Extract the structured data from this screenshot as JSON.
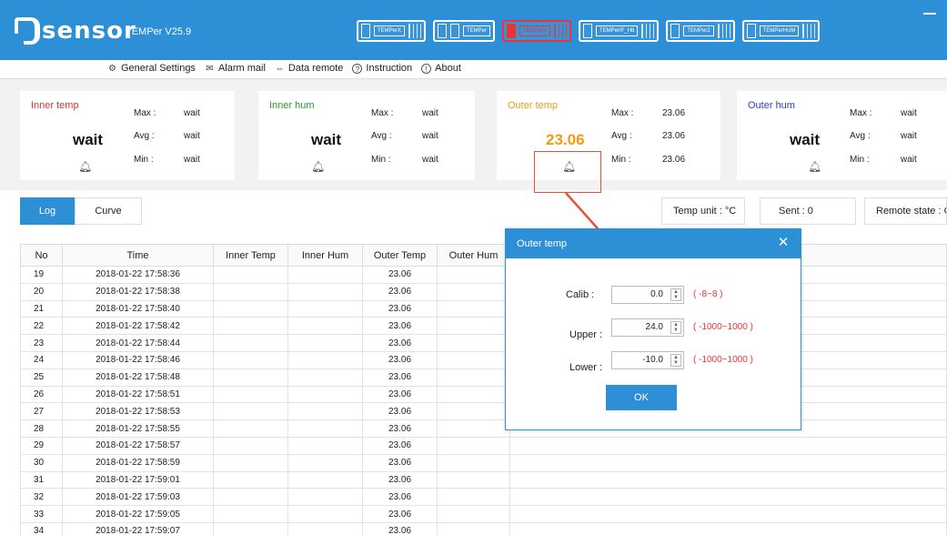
{
  "app": {
    "logo_text": "sensor",
    "version": "TEMPer V25.9"
  },
  "devices": [
    {
      "label": "TEMPerX",
      "active": false
    },
    {
      "label": "TEMPer",
      "active": false
    },
    {
      "label": "TEMPerX",
      "active": true
    },
    {
      "label": "TEMPerIF_H8",
      "active": false
    },
    {
      "label": "TEMPer2",
      "active": false
    },
    {
      "label": "TEMPerHUM",
      "active": false
    }
  ],
  "menu": {
    "general_settings": "General Settings",
    "alarm_mail": "Alarm mail",
    "data_remote": "Data remote",
    "instruction": "Instruction",
    "about": "About"
  },
  "panels": {
    "inner_temp": {
      "title": "Inner temp",
      "value": "wait",
      "max_label": "Max :",
      "max": "wait",
      "avg_label": "Avg :",
      "avg": "wait",
      "min_label": "Min :",
      "min": "wait",
      "color": "#e33030"
    },
    "inner_hum": {
      "title": "Inner hum",
      "value": "wait",
      "max_label": "Max :",
      "max": "wait",
      "avg_label": "Avg :",
      "avg": "wait",
      "min_label": "Min :",
      "min": "wait",
      "color": "#2a9a2a"
    },
    "outer_temp": {
      "title": "Outer temp",
      "value": "23.06",
      "max_label": "Max :",
      "max": "23.06",
      "avg_label": "Avg :",
      "avg": "23.06",
      "min_label": "Min :",
      "min": "23.06",
      "color": "#f59a12"
    },
    "outer_hum": {
      "title": "Outer hum",
      "value": "wait",
      "max_label": "Max :",
      "max": "wait",
      "avg_label": "Avg :",
      "avg": "wait",
      "min_label": "Min :",
      "min": "wait",
      "color": "#2a3fc2"
    }
  },
  "tabs": {
    "log": "Log",
    "curve": "Curve"
  },
  "status": {
    "temp_unit": "Temp unit : °C",
    "sent": "Sent :   0",
    "remote_state": "Remote state : OFF"
  },
  "table": {
    "headers": [
      "No",
      "Time",
      "Inner Temp",
      "Inner Hum",
      "Outer Temp",
      "Outer Hum"
    ],
    "rows": [
      [
        "19",
        "2018-01-22 17:58:36",
        "",
        "",
        "23.06",
        ""
      ],
      [
        "20",
        "2018-01-22 17:58:38",
        "",
        "",
        "23.06",
        ""
      ],
      [
        "21",
        "2018-01-22 17:58:40",
        "",
        "",
        "23.06",
        ""
      ],
      [
        "22",
        "2018-01-22 17:58:42",
        "",
        "",
        "23.06",
        ""
      ],
      [
        "23",
        "2018-01-22 17:58:44",
        "",
        "",
        "23.06",
        ""
      ],
      [
        "24",
        "2018-01-22 17:58:46",
        "",
        "",
        "23.06",
        ""
      ],
      [
        "25",
        "2018-01-22 17:58:48",
        "",
        "",
        "23.06",
        ""
      ],
      [
        "26",
        "2018-01-22 17:58:51",
        "",
        "",
        "23.06",
        ""
      ],
      [
        "27",
        "2018-01-22 17:58:53",
        "",
        "",
        "23.06",
        ""
      ],
      [
        "28",
        "2018-01-22 17:58:55",
        "",
        "",
        "23.06",
        ""
      ],
      [
        "29",
        "2018-01-22 17:58:57",
        "",
        "",
        "23.06",
        ""
      ],
      [
        "30",
        "2018-01-22 17:58:59",
        "",
        "",
        "23.06",
        ""
      ],
      [
        "31",
        "2018-01-22 17:59:01",
        "",
        "",
        "23.06",
        ""
      ],
      [
        "32",
        "2018-01-22 17:59:03",
        "",
        "",
        "23.06",
        ""
      ],
      [
        "33",
        "2018-01-22 17:59:05",
        "",
        "",
        "23.06",
        ""
      ],
      [
        "34",
        "2018-01-22 17:59:07",
        "",
        "",
        "23.06",
        ""
      ]
    ]
  },
  "dialog": {
    "title": "Outer temp",
    "calib_label": "Calib :",
    "calib_value": "0.0",
    "calib_range": "( -8~8 )",
    "upper_label": "Upper :",
    "upper_value": "24.0",
    "upper_range": "( -1000~1000 )",
    "lower_label": "Lower :",
    "lower_value": "-10.0",
    "lower_range": "( -1000~1000 )",
    "ok_label": "OK"
  },
  "colors": {
    "accent": "#2d8fd6",
    "highlight": "#e8503a"
  }
}
